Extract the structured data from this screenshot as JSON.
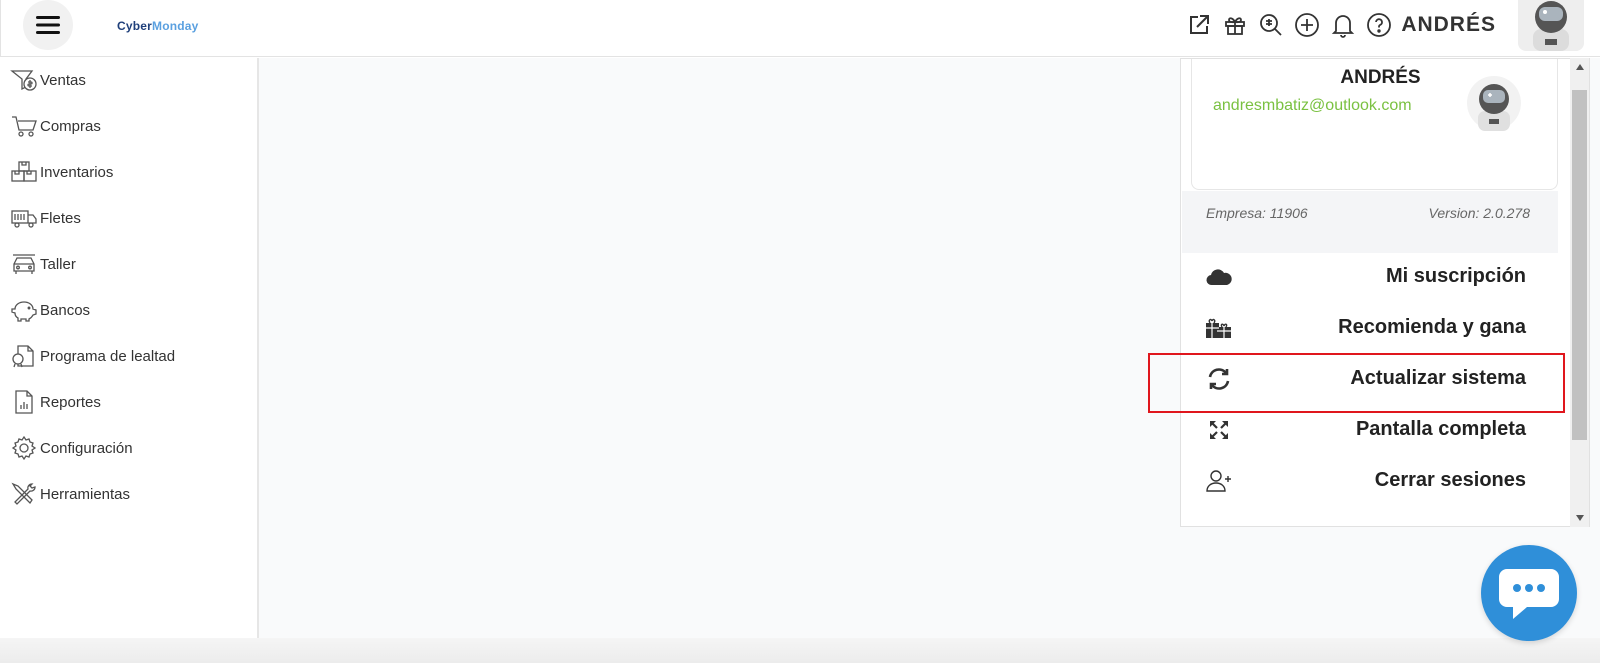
{
  "header": {
    "logo_part1": "Cyber",
    "logo_part2": "Monday",
    "user_name": "ANDRÉS",
    "icons": [
      "external-link-icon",
      "gift-icon",
      "search-icon",
      "add-icon",
      "bell-icon",
      "help-icon"
    ]
  },
  "sidebar": {
    "items": [
      {
        "label": "Ventas",
        "icon": "sales-icon"
      },
      {
        "label": "Compras",
        "icon": "cart-icon"
      },
      {
        "label": "Inventarios",
        "icon": "boxes-icon"
      },
      {
        "label": "Fletes",
        "icon": "truck-icon"
      },
      {
        "label": "Taller",
        "icon": "car-icon"
      },
      {
        "label": "Bancos",
        "icon": "piggy-bank-icon"
      },
      {
        "label": "Programa de lealtad",
        "icon": "loyalty-icon"
      },
      {
        "label": "Reportes",
        "icon": "report-icon"
      },
      {
        "label": "Configuración",
        "icon": "gear-icon"
      },
      {
        "label": "Herramientas",
        "icon": "tools-icon"
      }
    ]
  },
  "profile_menu": {
    "name": "ANDRÉS",
    "email": "andresmbatiz@outlook.com",
    "empresa": "Empresa: 11906",
    "version": "Version: 2.0.278",
    "items": [
      {
        "label": "Mi suscripción",
        "icon": "cloud-icon"
      },
      {
        "label": "Recomienda y gana",
        "icon": "gifts-icon"
      },
      {
        "label": "Actualizar sistema",
        "icon": "refresh-icon"
      },
      {
        "label": "Pantalla completa",
        "icon": "expand-icon"
      },
      {
        "label": "Cerrar sesiones",
        "icon": "user-plus-icon"
      }
    ]
  },
  "colors": {
    "email": "#7ac141",
    "highlight": "#e0161d",
    "chat": "#2f8fd9"
  }
}
